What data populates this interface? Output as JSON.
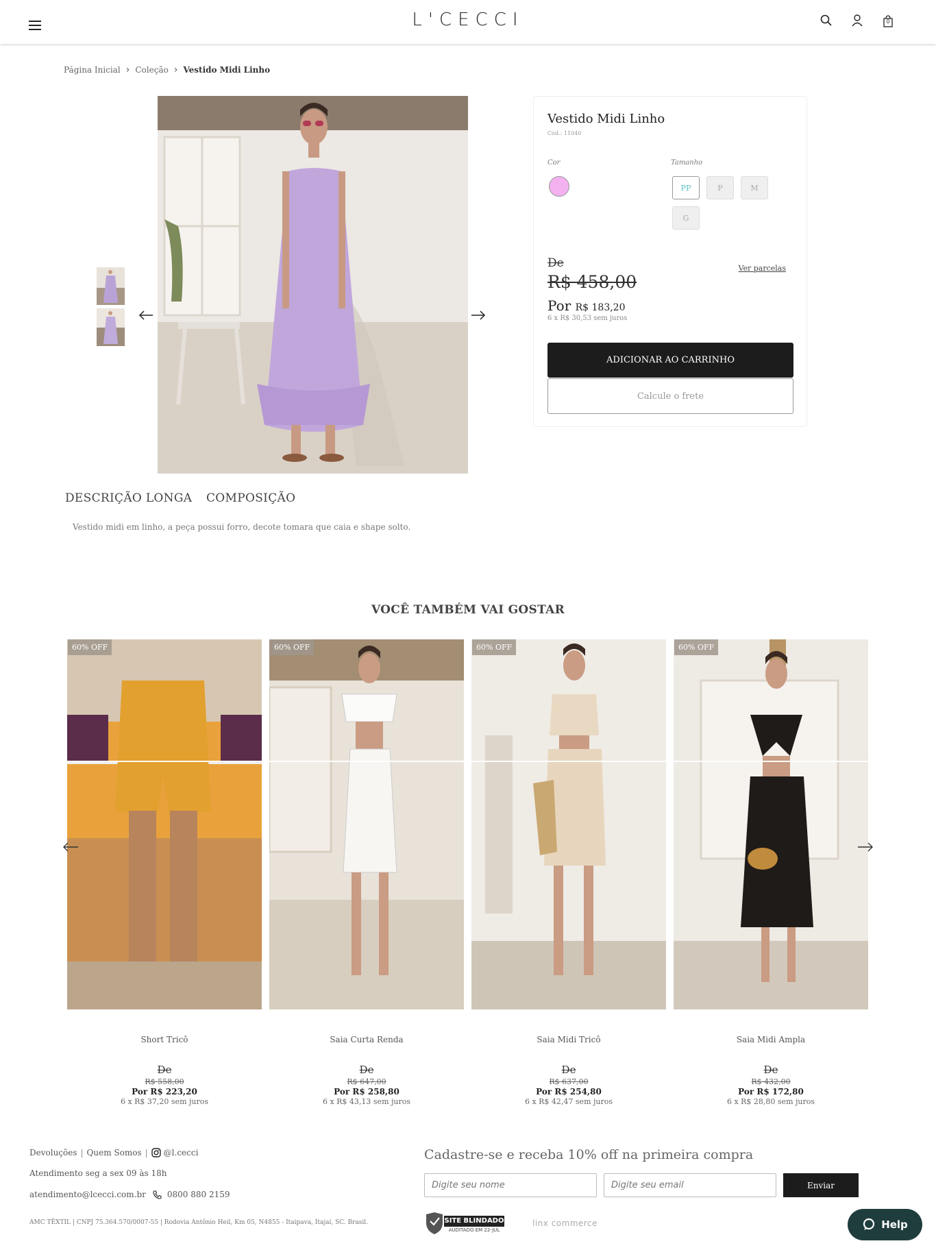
{
  "header": {
    "logo": "L'CECCI",
    "icons": [
      "menu-icon",
      "search-icon",
      "user-icon",
      "bag-icon"
    ],
    "bag_count": "0"
  },
  "breadcrumb": {
    "items": [
      "Página Inicial",
      "Coleção"
    ],
    "current": "Vestido Midi Linho"
  },
  "product": {
    "title": "Vestido Midi Linho",
    "code": "Cód.: 11040",
    "color_label": "Cor",
    "color_value": "#f3b2ef",
    "size_label": "Tamanho",
    "sizes": [
      "PP",
      "P",
      "M",
      "G"
    ],
    "selected_size": "PP",
    "de_label": "De",
    "old_price": "R$ 458,00",
    "por_label": "Por",
    "price": "R$ 183,20",
    "installments": "6 x R$ 30,53 sem juros",
    "see_installments": "Ver parcelas",
    "add_to_cart": "ADICIONAR AO CARRINHO",
    "shipping": "Calcule o frete"
  },
  "tabs": {
    "description": "DESCRIÇÃO LONGA",
    "composition": "COMPOSIÇÃO"
  },
  "description_text": "Vestido midi em linho, a peça possui forro, decote tomara que caia e shape solto.",
  "recommendations": {
    "title": "VOCÊ TAMBÉM VAI GOSTAR",
    "items": [
      {
        "badge": "60% OFF",
        "name": "Short Tricô",
        "de": "De",
        "old_price": "R$ 558,00",
        "price": "Por R$ 223,20",
        "installments": "6 x R$ 37,20 sem juros"
      },
      {
        "badge": "60% OFF",
        "name": "Saia Curta Renda",
        "de": "De",
        "old_price": "R$ 647,00",
        "price": "Por R$ 258,80",
        "installments": "6 x R$ 43,13 sem juros"
      },
      {
        "badge": "60% OFF",
        "name": "Saia Midi Tricô",
        "de": "De",
        "old_price": "R$ 637,00",
        "price": "Por R$ 254,80",
        "installments": "6 x R$ 42,47 sem juros"
      },
      {
        "badge": "60% OFF",
        "name": "Saia Midi Ampla",
        "de": "De",
        "old_price": "R$ 432,00",
        "price": "Por R$ 172,80",
        "installments": "6 x R$ 28,80 sem juros"
      }
    ]
  },
  "footer": {
    "links": [
      "Devoluções",
      "Quem Somos"
    ],
    "instagram": "@l.cecci",
    "hours": "Atendimento seg a sex 09 às 18h",
    "email": "atendimento@lcecci.com.br",
    "phone": "0800 880 2159",
    "legal": "AMC TÊXTIL | CNPJ 75.364.570/0007-55 | Rodovia Antônio Heil, Km 05, N4855 - Itaipava, Itajaí, SC. Brasil.",
    "newsletter_title": "Cadastre-se e receba 10% off na primeira compra",
    "name_placeholder": "Digite seu nome",
    "email_placeholder": "Digite seu email",
    "submit": "Enviar",
    "seal_title": "SITE BLINDADO",
    "seal_sub": "AUDITADO EM 22-JUL",
    "platform": "linx commerce",
    "help": "Help"
  }
}
